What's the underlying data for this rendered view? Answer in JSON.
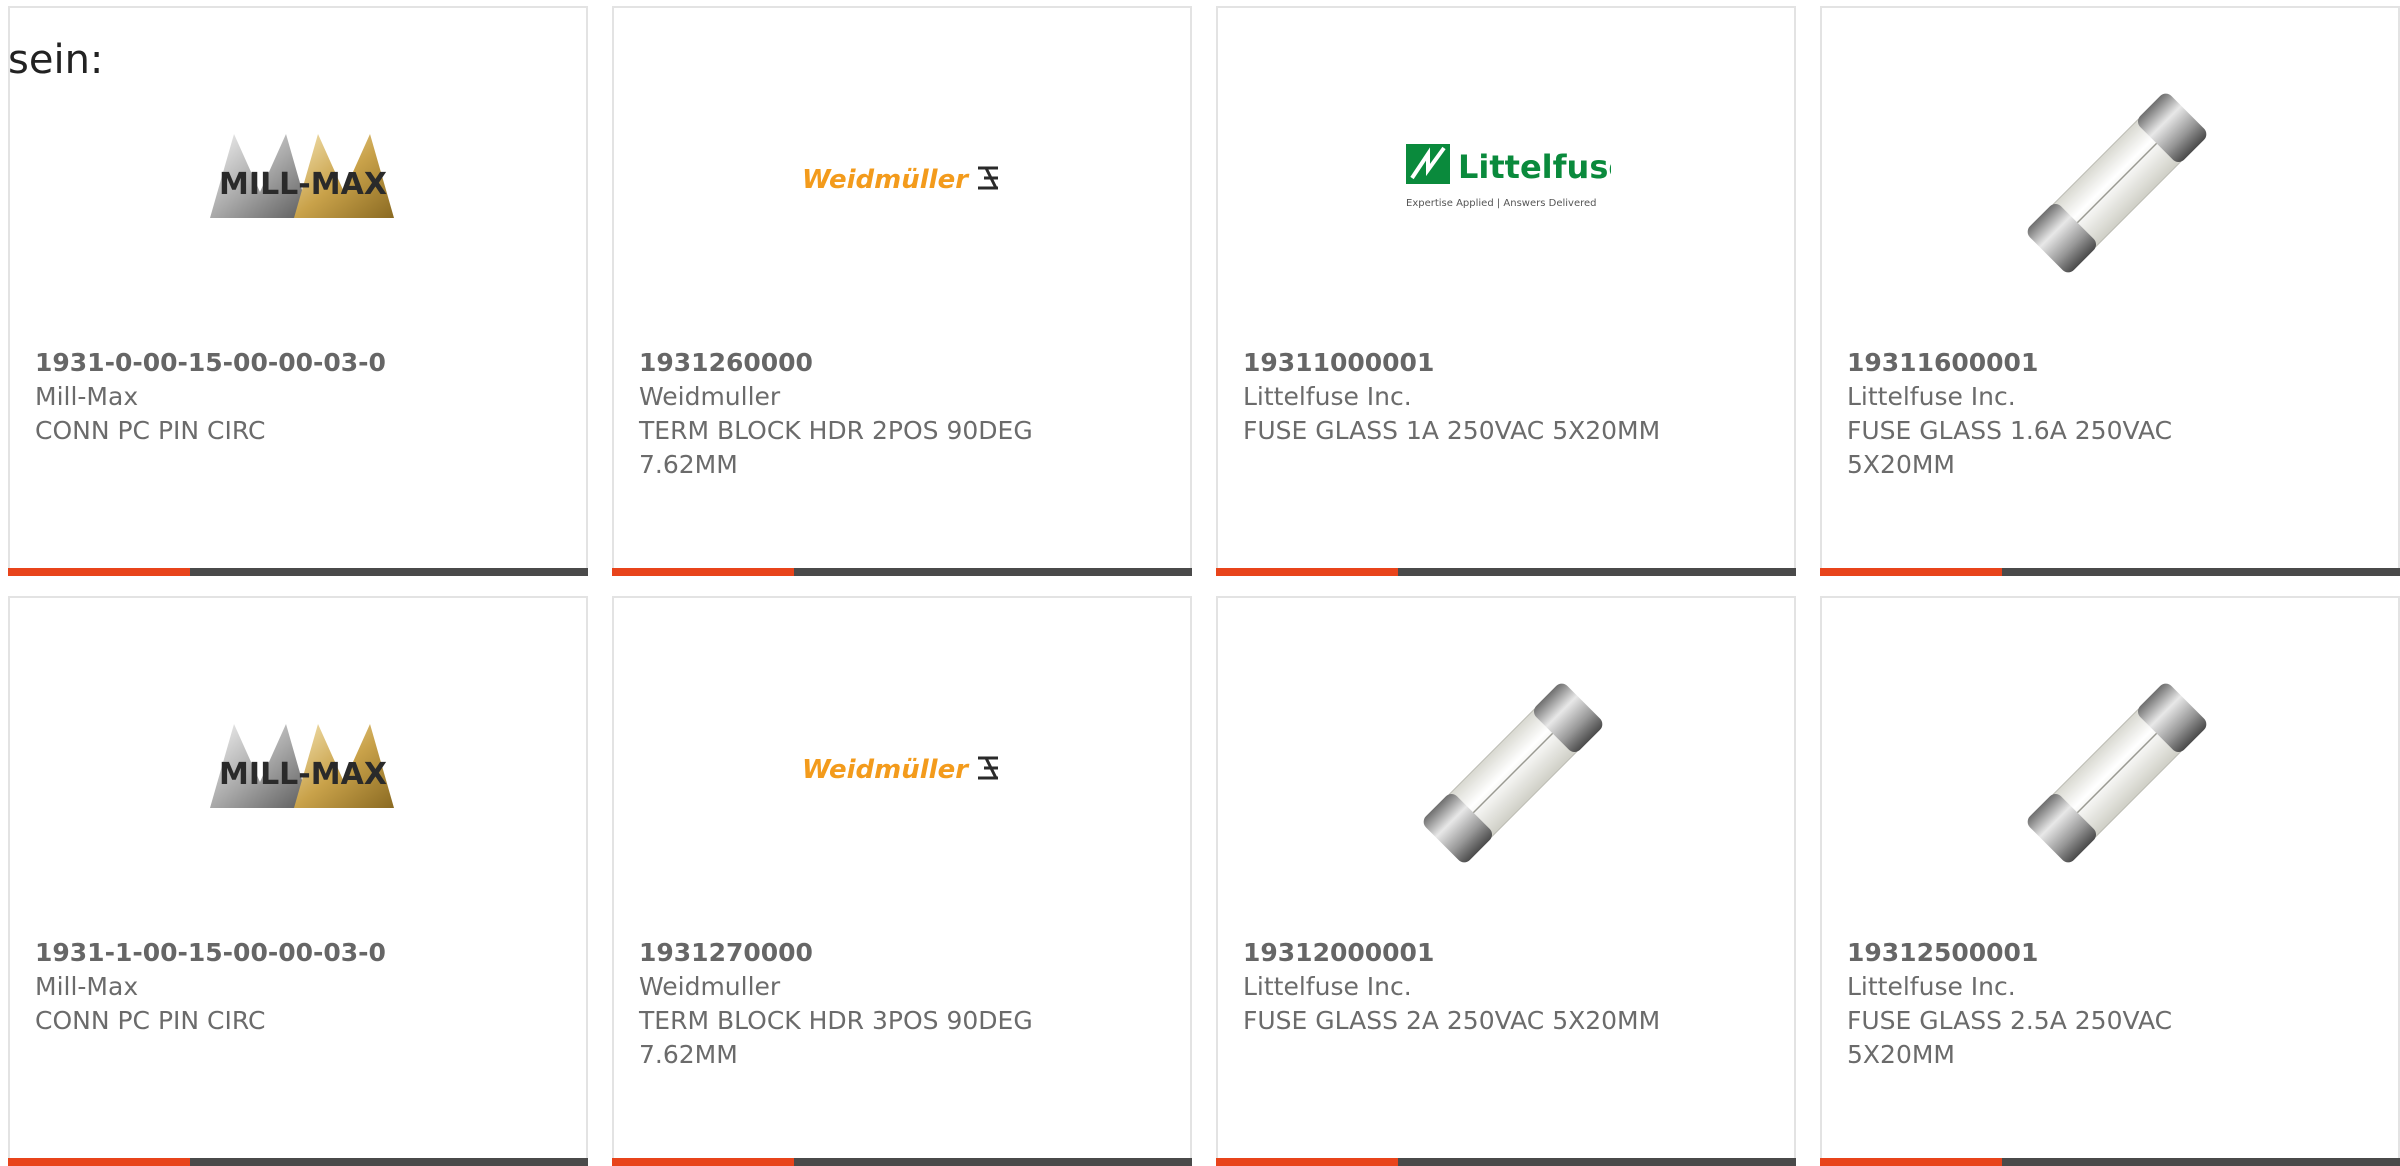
{
  "page": {
    "heading": "sein:"
  },
  "colors": {
    "accent": "#e8441b",
    "bar": "#4a4a4a",
    "border": "#e3e3e3",
    "text": "#6b6b6b"
  },
  "products": [
    {
      "part_number": "1931-0-00-15-00-00-03-0",
      "manufacturer": "Mill-Max",
      "description": "CONN PC PIN CIRC",
      "image": "mill-max-logo",
      "logo_text": "MILL-MAX"
    },
    {
      "part_number": "1931260000",
      "manufacturer": "Weidmuller",
      "description": "TERM BLOCK HDR 2POS 90DEG 7.62MM",
      "image": "weidmuller-logo",
      "logo_text": "Weidmüller"
    },
    {
      "part_number": "19311000001",
      "manufacturer": "Littelfuse Inc.",
      "description": "FUSE GLASS 1A 250VAC 5X20MM",
      "image": "littelfuse-logo",
      "logo_text": "Littelfuse",
      "logo_tagline": "Expertise Applied | Answers Delivered"
    },
    {
      "part_number": "19311600001",
      "manufacturer": "Littelfuse Inc.",
      "description": "FUSE GLASS 1.6A 250VAC 5X20MM",
      "image": "glass-fuse-photo"
    },
    {
      "part_number": "1931-1-00-15-00-00-03-0",
      "manufacturer": "Mill-Max",
      "description": "CONN PC PIN CIRC",
      "image": "mill-max-logo",
      "logo_text": "MILL-MAX"
    },
    {
      "part_number": "1931270000",
      "manufacturer": "Weidmuller",
      "description": "TERM BLOCK HDR 3POS 90DEG 7.62MM",
      "image": "weidmuller-logo",
      "logo_text": "Weidmüller"
    },
    {
      "part_number": "19312000001",
      "manufacturer": "Littelfuse Inc.",
      "description": "FUSE GLASS 2A 250VAC 5X20MM",
      "image": "glass-fuse-photo"
    },
    {
      "part_number": "19312500001",
      "manufacturer": "Littelfuse Inc.",
      "description": "FUSE GLASS 2.5A 250VAC 5X20MM",
      "image": "glass-fuse-photo"
    }
  ]
}
